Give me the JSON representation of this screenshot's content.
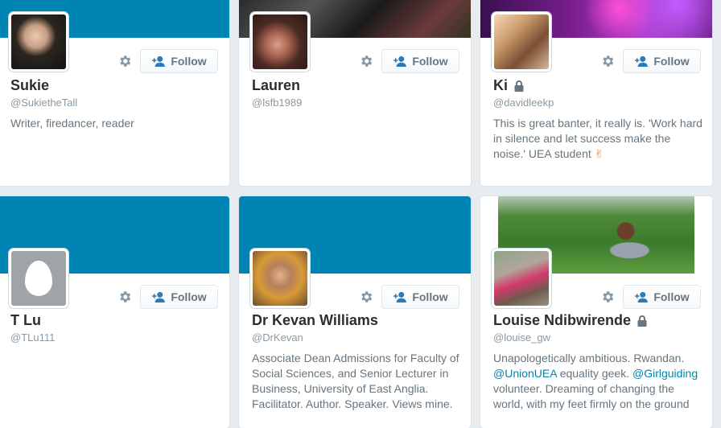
{
  "buttons": {
    "follow_label": "Follow"
  },
  "cards": [
    {
      "name": "Sukie",
      "handle": "@SukietheTall",
      "bio": "Writer, firedancer, reader",
      "protected": false
    },
    {
      "name": "Lauren",
      "handle": "@lsfb1989",
      "bio": "",
      "protected": false
    },
    {
      "name": "Ki",
      "handle": "@davidleekp",
      "bio": "This is great banter, it really is. 'Work hard in silence and let success make the noise.' UEA student",
      "bio_emoji": "✌",
      "protected": true
    },
    {
      "name": "T Lu",
      "handle": "@TLu111",
      "bio": "",
      "protected": false
    },
    {
      "name": "Dr Kevan Williams",
      "handle": "@DrKevan",
      "bio": "Associate Dean Admissions for Faculty of Social Sciences, and Senior Lecturer in Business, University of East Anglia. Facilitator. Author. Speaker. Views mine.",
      "protected": false
    },
    {
      "name": "Louise Ndibwirende",
      "handle": "@louise_gw",
      "protected": true,
      "bio_parts": {
        "p1": "Unapologetically ambitious. Rwandan. ",
        "mention1": "@UnionUEA",
        "p2": " equality geek. ",
        "mention2": "@Girlguiding",
        "p3": " volunteer. Dreaming of changing the world, with my feet firmly on the ground"
      }
    }
  ],
  "colors": {
    "banner_blue": "#0084b4",
    "link": "#0084b4",
    "page_bg": "#e6ecf0"
  },
  "icons": [
    "gear-icon",
    "follow-person-plus-icon",
    "lock-icon",
    "default-egg-avatar"
  ]
}
